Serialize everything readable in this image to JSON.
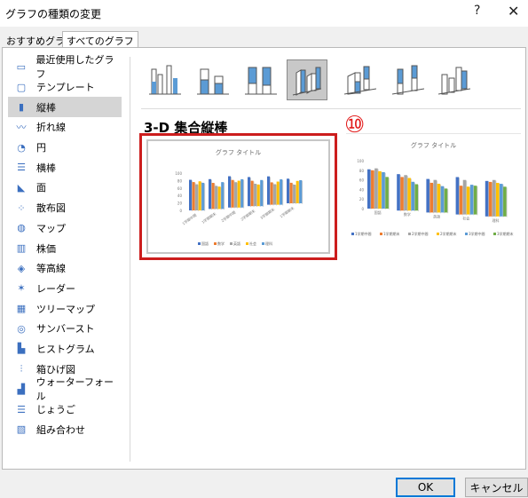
{
  "dialog": {
    "title": "グラフの種類の変更",
    "help": "?",
    "close": "✕"
  },
  "tabs": [
    "おすすめグラフ",
    "すべてのグラフ"
  ],
  "sidebar": {
    "items": [
      {
        "label": "最近使用したグラフ",
        "icon": "recent-folder-icon"
      },
      {
        "label": "テンプレート",
        "icon": "template-folder-icon"
      },
      {
        "label": "縦棒",
        "icon": "column-chart-icon",
        "selected": true
      },
      {
        "label": "折れ線",
        "icon": "line-chart-icon"
      },
      {
        "label": "円",
        "icon": "pie-chart-icon"
      },
      {
        "label": "横棒",
        "icon": "bar-chart-icon"
      },
      {
        "label": "面",
        "icon": "area-chart-icon"
      },
      {
        "label": "散布図",
        "icon": "scatter-chart-icon"
      },
      {
        "label": "マップ",
        "icon": "map-chart-icon"
      },
      {
        "label": "株価",
        "icon": "stock-chart-icon"
      },
      {
        "label": "等高線",
        "icon": "surface-chart-icon"
      },
      {
        "label": "レーダー",
        "icon": "radar-chart-icon"
      },
      {
        "label": "ツリーマップ",
        "icon": "treemap-chart-icon"
      },
      {
        "label": "サンバースト",
        "icon": "sunburst-chart-icon"
      },
      {
        "label": "ヒストグラム",
        "icon": "histogram-chart-icon"
      },
      {
        "label": "箱ひげ図",
        "icon": "boxwhisker-chart-icon"
      },
      {
        "label": "ウォーターフォール",
        "icon": "waterfall-chart-icon"
      },
      {
        "label": "じょうご",
        "icon": "funnel-chart-icon"
      },
      {
        "label": "組み合わせ",
        "icon": "combo-chart-icon"
      }
    ]
  },
  "subtypes_selected_index": 3,
  "section_title": "3-D 集合縦棒",
  "annotation": "⑩",
  "colors": {
    "accent": "#4472c4",
    "orange": "#ed7d31",
    "gray": "#a5a5a5",
    "yellow": "#ffc000",
    "blue2": "#5b9bd5",
    "green": "#70ad47",
    "highlight": "#cc1d1d"
  },
  "preview1": {
    "title": "グラフ タイトル",
    "chart_data": {
      "type": "bar",
      "categories": [
        "1学期中間",
        "1学期期末",
        "2学期中間",
        "2学期期末",
        "3学期期末",
        "1学期期末"
      ],
      "yticks": [
        "100",
        "80",
        "60",
        "40",
        "20",
        "0"
      ],
      "ylim": [
        0,
        100
      ],
      "legend": [
        "国語",
        "数学",
        "英語",
        "社会",
        "理科"
      ],
      "series": [
        {
          "values": [
            82,
            80,
            84,
            78,
            76,
            66
          ]
        },
        {
          "values": [
            76,
            70,
            74,
            68,
            60,
            55
          ]
        },
        {
          "values": [
            70,
            62,
            68,
            60,
            55,
            50
          ]
        },
        {
          "values": [
            78,
            60,
            72,
            58,
            62,
            60
          ]
        },
        {
          "values": [
            74,
            72,
            76,
            70,
            68,
            62
          ]
        }
      ]
    }
  },
  "preview2": {
    "title": "グラフ タイトル",
    "chart_data": {
      "type": "bar",
      "categories": [
        "国語",
        "数学",
        "英語",
        "社会",
        "理科"
      ],
      "yticks": [
        "100",
        "80",
        "60",
        "40",
        "20",
        "0"
      ],
      "ylim": [
        0,
        100
      ],
      "legend": [
        "1学期中間",
        "1学期期末",
        "2学期中間",
        "2学期期末",
        "3学期中間",
        "3学期期末"
      ],
      "series": [
        {
          "values": [
            82,
            76,
            70,
            78,
            74
          ]
        },
        {
          "values": [
            80,
            70,
            62,
            60,
            72
          ]
        },
        {
          "values": [
            84,
            74,
            68,
            72,
            76
          ]
        },
        {
          "values": [
            78,
            68,
            60,
            58,
            70
          ]
        },
        {
          "values": [
            76,
            60,
            55,
            62,
            68
          ]
        },
        {
          "values": [
            66,
            55,
            50,
            60,
            62
          ]
        }
      ]
    }
  },
  "buttons": {
    "ok": "OK",
    "cancel": "キャンセル"
  }
}
